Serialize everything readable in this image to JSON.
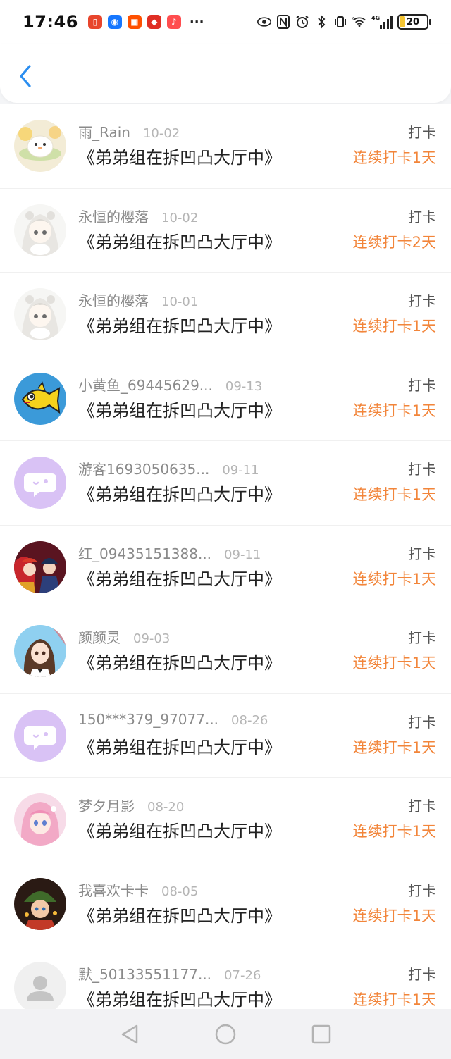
{
  "status_bar": {
    "time": "17:46",
    "network_label": "4G",
    "wifi_label": "6",
    "battery_level": "20"
  },
  "checkins": [
    {
      "name": "雨_Rain",
      "date": "10-02",
      "title": "《弟弟组在拆凹凸大厅中》",
      "type": "打卡",
      "streak": "连续打卡1天",
      "avatar": "chick"
    },
    {
      "name": "永恒的樱落",
      "date": "10-02",
      "title": "《弟弟组在拆凹凸大厅中》",
      "type": "打卡",
      "streak": "连续打卡2天",
      "avatar": "anime-white"
    },
    {
      "name": "永恒的樱落",
      "date": "10-01",
      "title": "《弟弟组在拆凹凸大厅中》",
      "type": "打卡",
      "streak": "连续打卡1天",
      "avatar": "anime-white"
    },
    {
      "name": "小黄鱼_69445629...",
      "date": "09-13",
      "title": "《弟弟组在拆凹凸大厅中》",
      "type": "打卡",
      "streak": "连续打卡1天",
      "avatar": "fish"
    },
    {
      "name": "游客1693050635...",
      "date": "09-11",
      "title": "《弟弟组在拆凹凸大厅中》",
      "type": "打卡",
      "streak": "连续打卡1天",
      "avatar": "chat-purple"
    },
    {
      "name": "红_09435151388...",
      "date": "09-11",
      "title": "《弟弟组在拆凹凸大厅中》",
      "type": "打卡",
      "streak": "连续打卡1天",
      "avatar": "anime-red"
    },
    {
      "name": "颜颜灵",
      "date": "09-03",
      "title": "《弟弟组在拆凹凸大厅中》",
      "type": "打卡",
      "streak": "连续打卡1天",
      "avatar": "anime-girl"
    },
    {
      "name": "150***379_97077...",
      "date": "08-26",
      "title": "《弟弟组在拆凹凸大厅中》",
      "type": "打卡",
      "streak": "连续打卡1天",
      "avatar": "chat-purple"
    },
    {
      "name": "梦夕月影",
      "date": "08-20",
      "title": "《弟弟组在拆凹凸大厅中》",
      "type": "打卡",
      "streak": "连续打卡1天",
      "avatar": "anime-pink"
    },
    {
      "name": "我喜欢卡卡",
      "date": "08-05",
      "title": "《弟弟组在拆凹凸大厅中》",
      "type": "打卡",
      "streak": "连续打卡1天",
      "avatar": "anime-dark"
    },
    {
      "name": "默_50133551177...",
      "date": "07-26",
      "title": "《弟弟组在拆凹凸大厅中》",
      "type": "打卡",
      "streak": "连续打卡1天",
      "avatar": "default-user"
    }
  ],
  "colors": {
    "streak": "#f2853a",
    "back_arrow": "#2b8ef0",
    "chat_avatar_bg": "#d9c2f5"
  },
  "icons": {
    "back": "chevron-left-icon",
    "nav_back": "triangle-back-icon",
    "nav_home": "circle-home-icon",
    "nav_recent": "square-recent-icon"
  }
}
